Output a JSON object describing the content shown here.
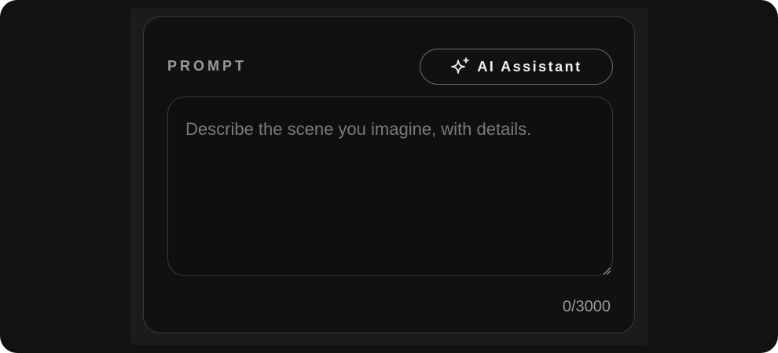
{
  "prompt_section": {
    "label": "PROMPT",
    "ai_button": {
      "label": "AI Assistant",
      "icon": "sparkle-icon"
    },
    "textarea": {
      "value": "",
      "placeholder": "Describe the scene you imagine, with details."
    },
    "counter": "0/3000"
  },
  "colors": {
    "background": "#121212",
    "card": "#111111",
    "border": "#3a3a3a",
    "label": "#9a9a9a",
    "button_text": "#f2f2f2",
    "placeholder": "#7a7a7a"
  }
}
